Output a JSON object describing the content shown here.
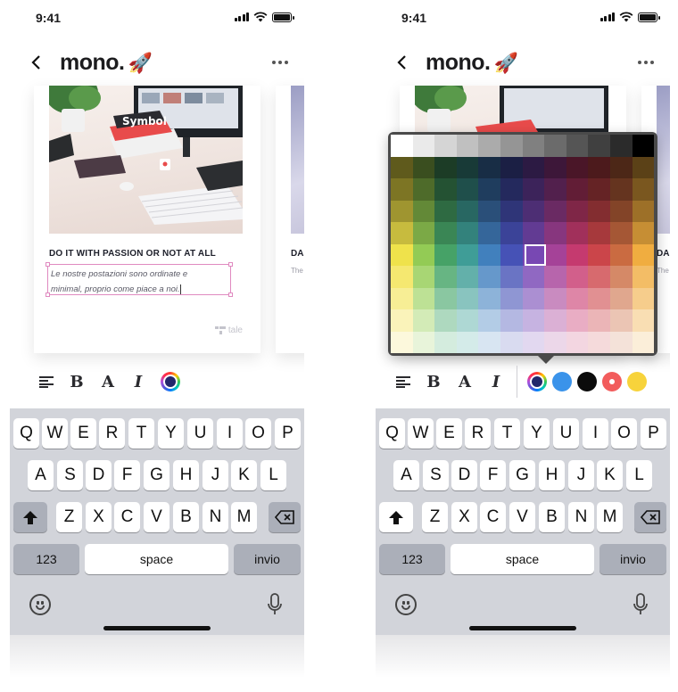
{
  "status": {
    "time": "9:41"
  },
  "app": {
    "title": "mono.",
    "title_emoji": "🚀"
  },
  "card": {
    "heading": "DO IT WITH PASSION OR NOT AT ALL",
    "body_line1": "Le nostre postazioni sono ordinate e",
    "body_line2": "minimal, proprio come piace a noi.",
    "brand": "tale"
  },
  "card2": {
    "heading": "DA",
    "sub": "The"
  },
  "toolbar": {
    "align_glyph": "≡",
    "bold_label": "B",
    "font_label": "A",
    "italic_label": "I"
  },
  "colors": {
    "selected": "#22276b",
    "swatches": [
      "#3a93ea",
      "#0b0b0b",
      "#f25c5c",
      "#f7d33b"
    ],
    "accent_selection": "#e08ac0"
  },
  "keyboard": {
    "row1": [
      "Q",
      "W",
      "E",
      "R",
      "T",
      "Y",
      "U",
      "I",
      "O",
      "P"
    ],
    "row2": [
      "A",
      "S",
      "D",
      "F",
      "G",
      "H",
      "J",
      "K",
      "L"
    ],
    "row3": [
      "Z",
      "X",
      "C",
      "V",
      "B",
      "N",
      "M"
    ],
    "numbers_label": "123",
    "space_label": "space",
    "return_label": "invio"
  },
  "palette": [
    [
      "#ffffff",
      "#eaeaea",
      "#d5d5d5",
      "#c0c0c0",
      "#ababab",
      "#959595",
      "#808080",
      "#6b6b6b",
      "#555555",
      "#404040",
      "#2b2b2b",
      "#000000"
    ],
    [
      "#5f5a1c",
      "#3a4e1f",
      "#1c3c26",
      "#183a37",
      "#182d45",
      "#1b1f44",
      "#2c1a43",
      "#3d1739",
      "#4a1628",
      "#4c1a1c",
      "#4c2717",
      "#5b4117"
    ],
    [
      "#7d7524",
      "#4e6b2a",
      "#245233",
      "#1f4f4b",
      "#1f3d5e",
      "#24295d",
      "#3c235a",
      "#52204d",
      "#621d36",
      "#652325",
      "#65341f",
      "#7a571f"
    ],
    [
      "#9f9530",
      "#638937",
      "#2e6a42",
      "#286762",
      "#2a4f79",
      "#2f3578",
      "#4d2e74",
      "#6a2a63",
      "#7f2647",
      "#832d30",
      "#834428",
      "#9d7028"
    ],
    [
      "#c7bb3e",
      "#7ba946",
      "#3a8655",
      "#33827c",
      "#35669a",
      "#3b4398",
      "#623b93",
      "#87367e",
      "#a1305b",
      "#a6393c",
      "#a55735",
      "#c68e34"
    ],
    [
      "#efe24b",
      "#93cb55",
      "#46a267",
      "#3f9d97",
      "#4180bd",
      "#4652b6",
      "#7848b3",
      "#a54298",
      "#c53a6f",
      "#cb454a",
      "#ca6b41",
      "#f0ad40"
    ],
    [
      "#f5e870",
      "#a8d674",
      "#67b583",
      "#63b0aa",
      "#6698cb",
      "#6a74c4",
      "#9068c2",
      "#b765ac",
      "#d25f8b",
      "#d76a6e",
      "#d58967",
      "#f3bd66"
    ],
    [
      "#f7ee95",
      "#bde195",
      "#8ac7a1",
      "#89c4bf",
      "#8db3d9",
      "#8f96d3",
      "#ab8fd2",
      "#c98bc0",
      "#de86a7",
      "#e19092",
      "#e0a78e",
      "#f6cd8c"
    ],
    [
      "#faf3ba",
      "#d3ebb7",
      "#aed9bf",
      "#aed8d4",
      "#b3cce6",
      "#b4b8e2",
      "#c6b3e1",
      "#dbb0d5",
      "#e9adc4",
      "#ebb5b7",
      "#ebc5b4",
      "#f9deb3"
    ],
    [
      "#fcf8dc",
      "#e8f4da",
      "#d4ecde",
      "#d4ebe9",
      "#d8e5f2",
      "#d9dbf0",
      "#e2d8f0",
      "#ecd7e9",
      "#f3d6e1",
      "#f5dadb",
      "#f4e2d9",
      "#fbeed9"
    ]
  ]
}
